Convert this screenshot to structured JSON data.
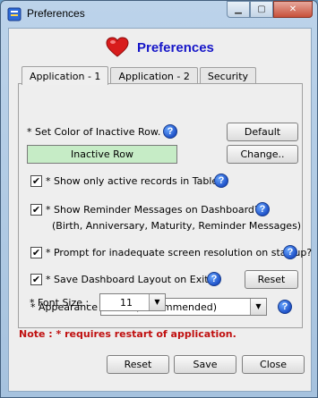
{
  "window": {
    "title": "Preferences"
  },
  "header": {
    "title": "Preferences"
  },
  "tabs": [
    {
      "label": "Application - 1",
      "active": true
    },
    {
      "label": "Application - 2",
      "active": false
    },
    {
      "label": "Security",
      "active": false
    }
  ],
  "color": {
    "label": "* Set Color of Inactive Row.",
    "swatch_text": "Inactive Row",
    "swatch_color": "#c6ecc6",
    "default_button": "Default",
    "change_button": "Change.."
  },
  "options": {
    "active_records": {
      "label": "* Show only active records in Table?",
      "checked": true
    },
    "reminders": {
      "label": "* Show Reminder Messages on Dashboard?",
      "sub": "(Birth, Anniversary, Maturity, Reminder Messages)",
      "checked": true
    },
    "resolution": {
      "label": "* Prompt for inadequate screen resolution on startup?",
      "checked": true
    },
    "layout": {
      "label": "* Save Dashboard Layout on Exit?",
      "checked": true,
      "reset_button": "Reset"
    }
  },
  "appearance": {
    "label": "* Appearance :",
    "value": "Metal (Recommended)"
  },
  "font_size": {
    "label": "* Font Size :",
    "value": "11"
  },
  "note": "Note : * requires restart of application.",
  "footer": {
    "reset": "Reset",
    "save": "Save",
    "close": "Close"
  },
  "icons": {
    "help": "help-icon",
    "heart": "heart-icon",
    "check": "✔",
    "help_glyph": "?"
  },
  "colors": {
    "accent": "#1616c8",
    "note": "#c01010",
    "heart": "#d81c1c"
  }
}
